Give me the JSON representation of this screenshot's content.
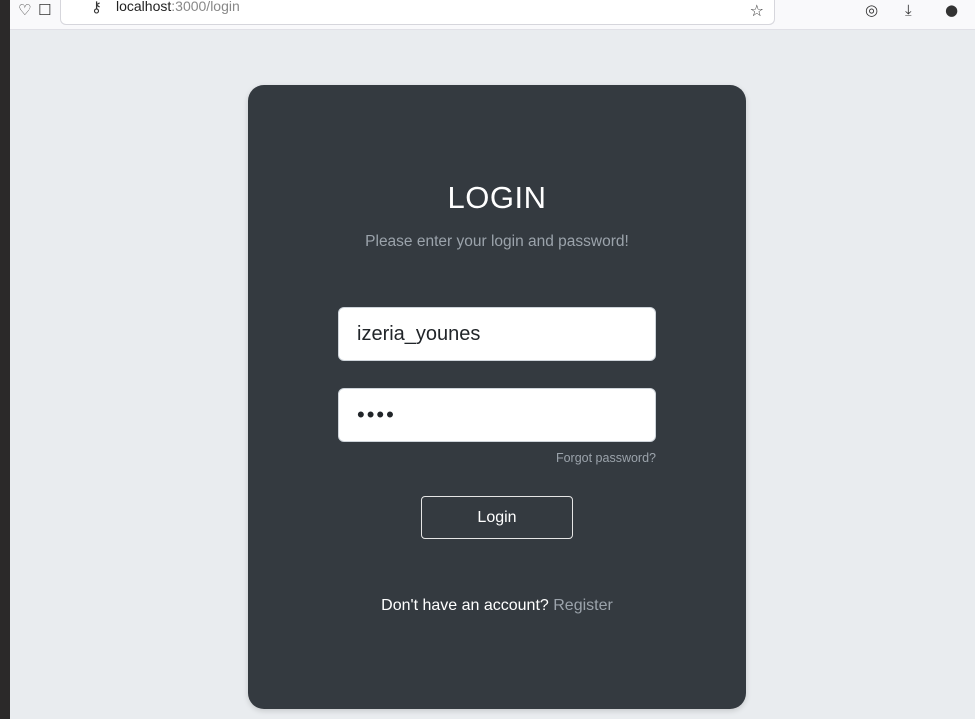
{
  "browser": {
    "url_host": "localhost",
    "url_path": ":3000/login"
  },
  "login": {
    "title": "LOGIN",
    "subtitle": "Please enter your login and password!",
    "username_value": "izeria_younes",
    "password_value": "••••",
    "forgot_label": "Forgot password?",
    "button_label": "Login",
    "no_account_text": "Don't have an account?",
    "register_label": "Register"
  },
  "colors": {
    "page_bg": "#e9ecef",
    "card_bg": "#343a40",
    "muted_text": "#9ba3ab"
  },
  "icons": [
    "shield-icon",
    "page-icon",
    "key-icon",
    "star-icon",
    "pocket-icon",
    "download-icon",
    "account-icon"
  ]
}
